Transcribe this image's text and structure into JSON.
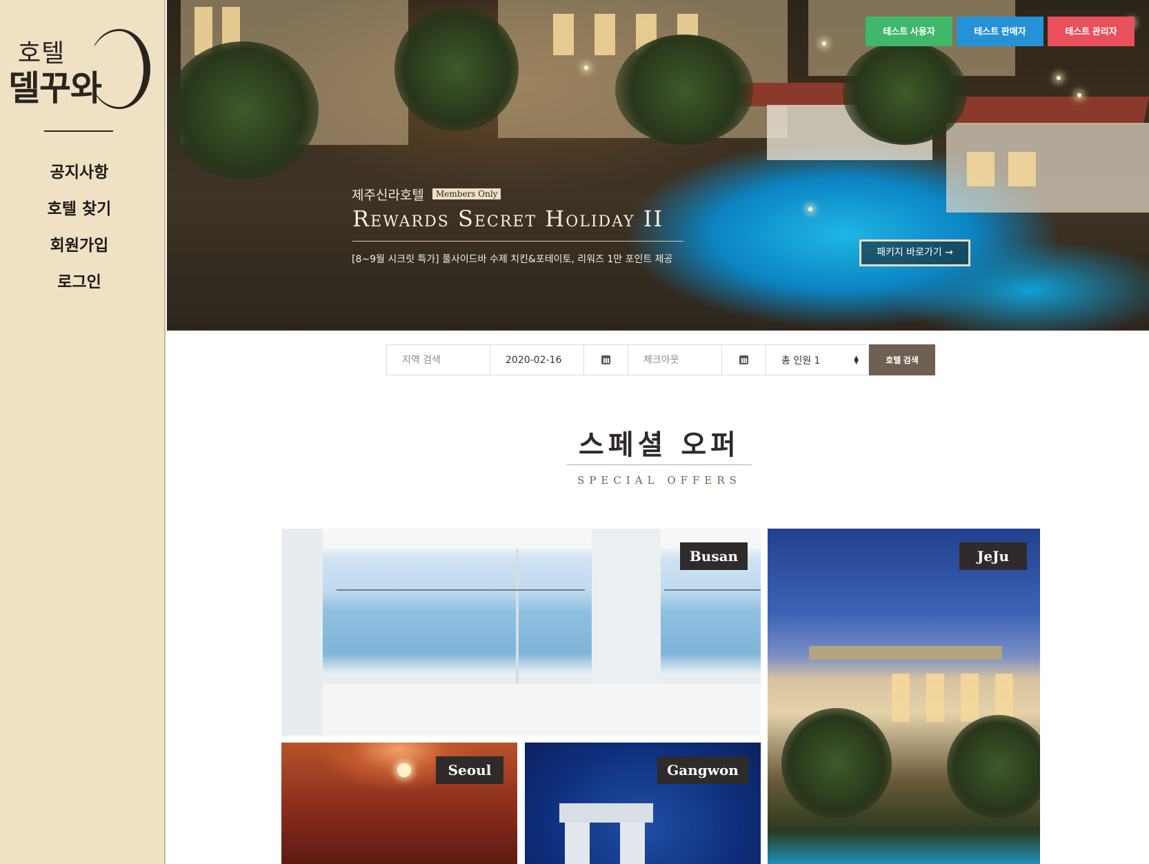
{
  "sidebar": {
    "logo": {
      "line1": "호텔",
      "line2": "델꾸와"
    },
    "nav": [
      "공지사항",
      "호텔 찾기",
      "회원가입",
      "로그인"
    ]
  },
  "hero": {
    "test_buttons": {
      "user": "테스트 사용자",
      "seller": "테스트 판매자",
      "admin": "테스트 관리자"
    },
    "promo": {
      "hotel": "제주신라호텔",
      "badge": "Members Only",
      "title": "Rewards Secret Holiday II",
      "description": "[8~9월 시크릿 특가] 풀사이드바 수제 치킨&포테이토, 리워즈 1만 포인트 제공",
      "package_button": "패키지 바로가기 →"
    }
  },
  "search": {
    "region_placeholder": "지역 검색",
    "checkin_value": "2020-02-16",
    "checkout_placeholder": "체크아웃",
    "guests_label": "총 인원 1",
    "search_button": "호텔 검색"
  },
  "special_offers": {
    "title": "스페셜 오퍼",
    "subtitle": "SPECIAL OFFERS",
    "tiles": [
      "Busan",
      "JeJu",
      "Seoul",
      "Gangwon"
    ]
  },
  "colors": {
    "sidebar_bg": "#efe1c4",
    "test_user": "#3fb86a",
    "test_seller": "#2592d8",
    "test_admin": "#e8505b",
    "search_button": "#6e6152",
    "tile_label_bg": "#2e2b2a"
  }
}
